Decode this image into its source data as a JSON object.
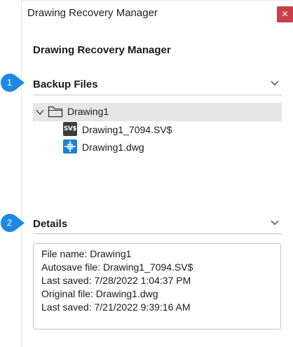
{
  "window": {
    "title": "Drawing Recovery Manager",
    "close_icon": "close-icon",
    "close_color": "#c8414a"
  },
  "panel": {
    "title": "Drawing Recovery Manager"
  },
  "callouts": [
    {
      "number": "1",
      "color": "#1e88e5"
    },
    {
      "number": "2",
      "color": "#1e88e5"
    }
  ],
  "backup_files": {
    "title": "Backup Files",
    "expanded": true,
    "tree": {
      "folder": {
        "label": "Drawing1",
        "icon": "folder-icon",
        "expanded": true,
        "selected": true
      },
      "files": [
        {
          "label": "Drawing1_7094.SV$",
          "icon": "sv-file-icon",
          "icon_text": "SV$"
        },
        {
          "label": "Drawing1.dwg",
          "icon": "dwg-file-icon"
        }
      ]
    }
  },
  "details": {
    "title": "Details",
    "expanded": true,
    "lines": [
      "File name: Drawing1",
      "Autosave file: Drawing1_7094.SV$",
      "Last saved: 7/28/2022 1:04:37 PM",
      "Original file: Drawing1.dwg",
      "Last saved: 7/21/2022 9:39:16 AM"
    ]
  },
  "colors": {
    "accent": "#1e88e5",
    "selection": "#e6e6e6",
    "dwg_icon": "#1e7fd6"
  }
}
